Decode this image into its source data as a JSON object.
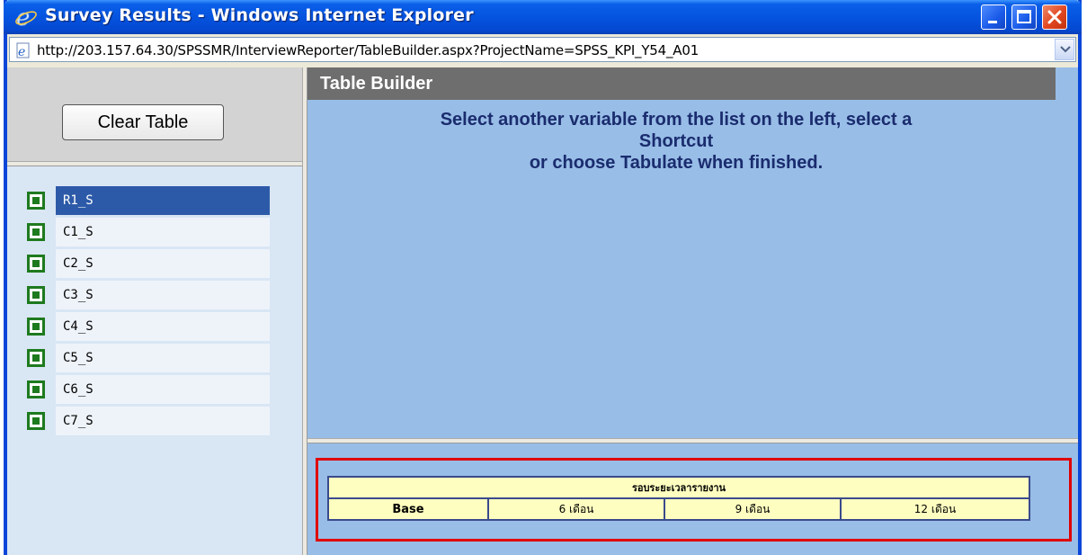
{
  "window": {
    "title": "Survey Results - Windows Internet Explorer",
    "url": "http://203.157.64.30/SPSSMR/InterviewReporter/TableBuilder.aspx?ProjectName=SPSS_KPI_Y54_A01"
  },
  "left_panel": {
    "clear_button_label": "Clear Table",
    "variables": [
      "R1_S",
      "C1_S",
      "C2_S",
      "C3_S",
      "C4_S",
      "C5_S",
      "C6_S",
      "C7_S"
    ],
    "selected_variable": "R1_S"
  },
  "table_builder": {
    "header": "Table Builder",
    "instruction_line1": "Select another variable from the list on the left, select a",
    "instruction_line2": "Shortcut",
    "instruction_line3": "or choose Tabulate when finished."
  },
  "preview_table": {
    "group_header": "รอบระยะเวลารายงาน",
    "columns": [
      "Base",
      "6 เดือน",
      "9 เดือน",
      "12 เดือน"
    ]
  },
  "colors": {
    "titlebar": "#0554e0",
    "selected_item": "#2d5aa8",
    "highlight_border": "#e00000",
    "panel_bg": "#98bde7",
    "table_cell_bg": "#fefec0"
  }
}
